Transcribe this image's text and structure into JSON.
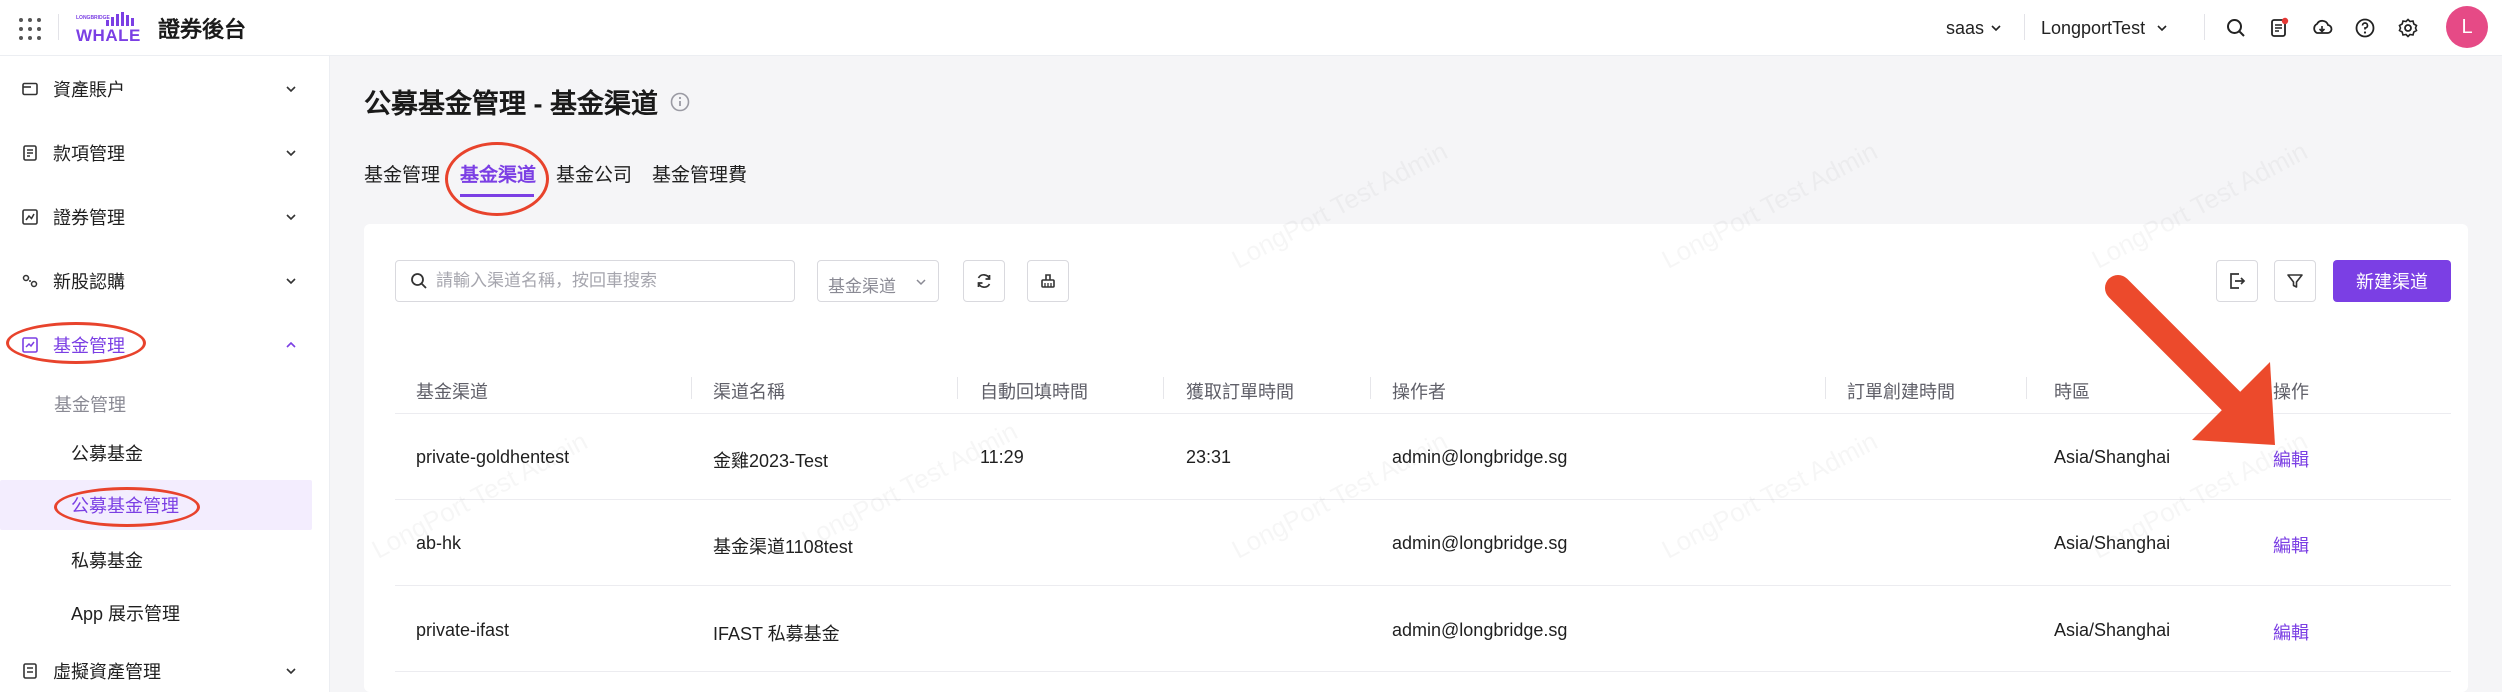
{
  "header": {
    "logo_small_text": "LONGBRIDGE",
    "logo_word": "WHALE",
    "app_title": "證券後台",
    "tenant_selector": "saas",
    "account_selector": "LongportTest",
    "avatar_initial": "L",
    "icons": [
      "apps-grid-icon",
      "search-icon",
      "document-notification-icon",
      "download-icon",
      "help-icon",
      "settings-icon"
    ]
  },
  "sidebar": {
    "items": [
      {
        "label": "資產賬户",
        "icon": "wallet-icon"
      },
      {
        "label": "款項管理",
        "icon": "ledger-icon"
      },
      {
        "label": "證券管理",
        "icon": "chart-icon"
      },
      {
        "label": "新股認購",
        "icon": "ipo-icon"
      },
      {
        "label": "基金管理",
        "icon": "fund-icon"
      },
      {
        "label": "虛擬資產管理",
        "icon": "crypto-icon"
      }
    ],
    "group_label": "基金管理",
    "subitems": [
      "公募基金",
      "公募基金管理",
      "私募基金",
      "App 展示管理"
    ]
  },
  "main": {
    "title": "公募基金管理 - 基金渠道",
    "tabs": [
      "基金管理",
      "基金渠道",
      "基金公司",
      "基金管理費"
    ],
    "active_tab": 1,
    "search_placeholder": "請輸入渠道名稱，按回車搜索",
    "filter_select": "基金渠道",
    "new_button": "新建渠道",
    "table": {
      "columns": [
        "基金渠道",
        "渠道名稱",
        "自動回填時間",
        "獲取訂單時間",
        "操作者",
        "訂單創建時間",
        "時區",
        "操作"
      ],
      "rows": [
        {
          "channel": "private-goldhentest",
          "name": "金雞2023-Test",
          "autofill": "11:29",
          "fetch": "23:31",
          "operator": "admin@longbridge.sg",
          "created": "",
          "tz": "Asia/Shanghai",
          "action": "編輯"
        },
        {
          "channel": "ab-hk",
          "name": "基金渠道1108test",
          "autofill": "",
          "fetch": "",
          "operator": "admin@longbridge.sg",
          "created": "",
          "tz": "Asia/Shanghai",
          "action": "編輯"
        },
        {
          "channel": "private-ifast",
          "name": "IFAST 私募基金",
          "autofill": "",
          "fetch": "",
          "operator": "admin@longbridge.sg",
          "created": "",
          "tz": "Asia/Shanghai",
          "action": "編輯"
        }
      ]
    },
    "watermark": "LongPort Test Admin"
  },
  "colors": {
    "accent": "#7b3fe4",
    "annotation": "#e8432c",
    "avatar": "#e64a86"
  }
}
